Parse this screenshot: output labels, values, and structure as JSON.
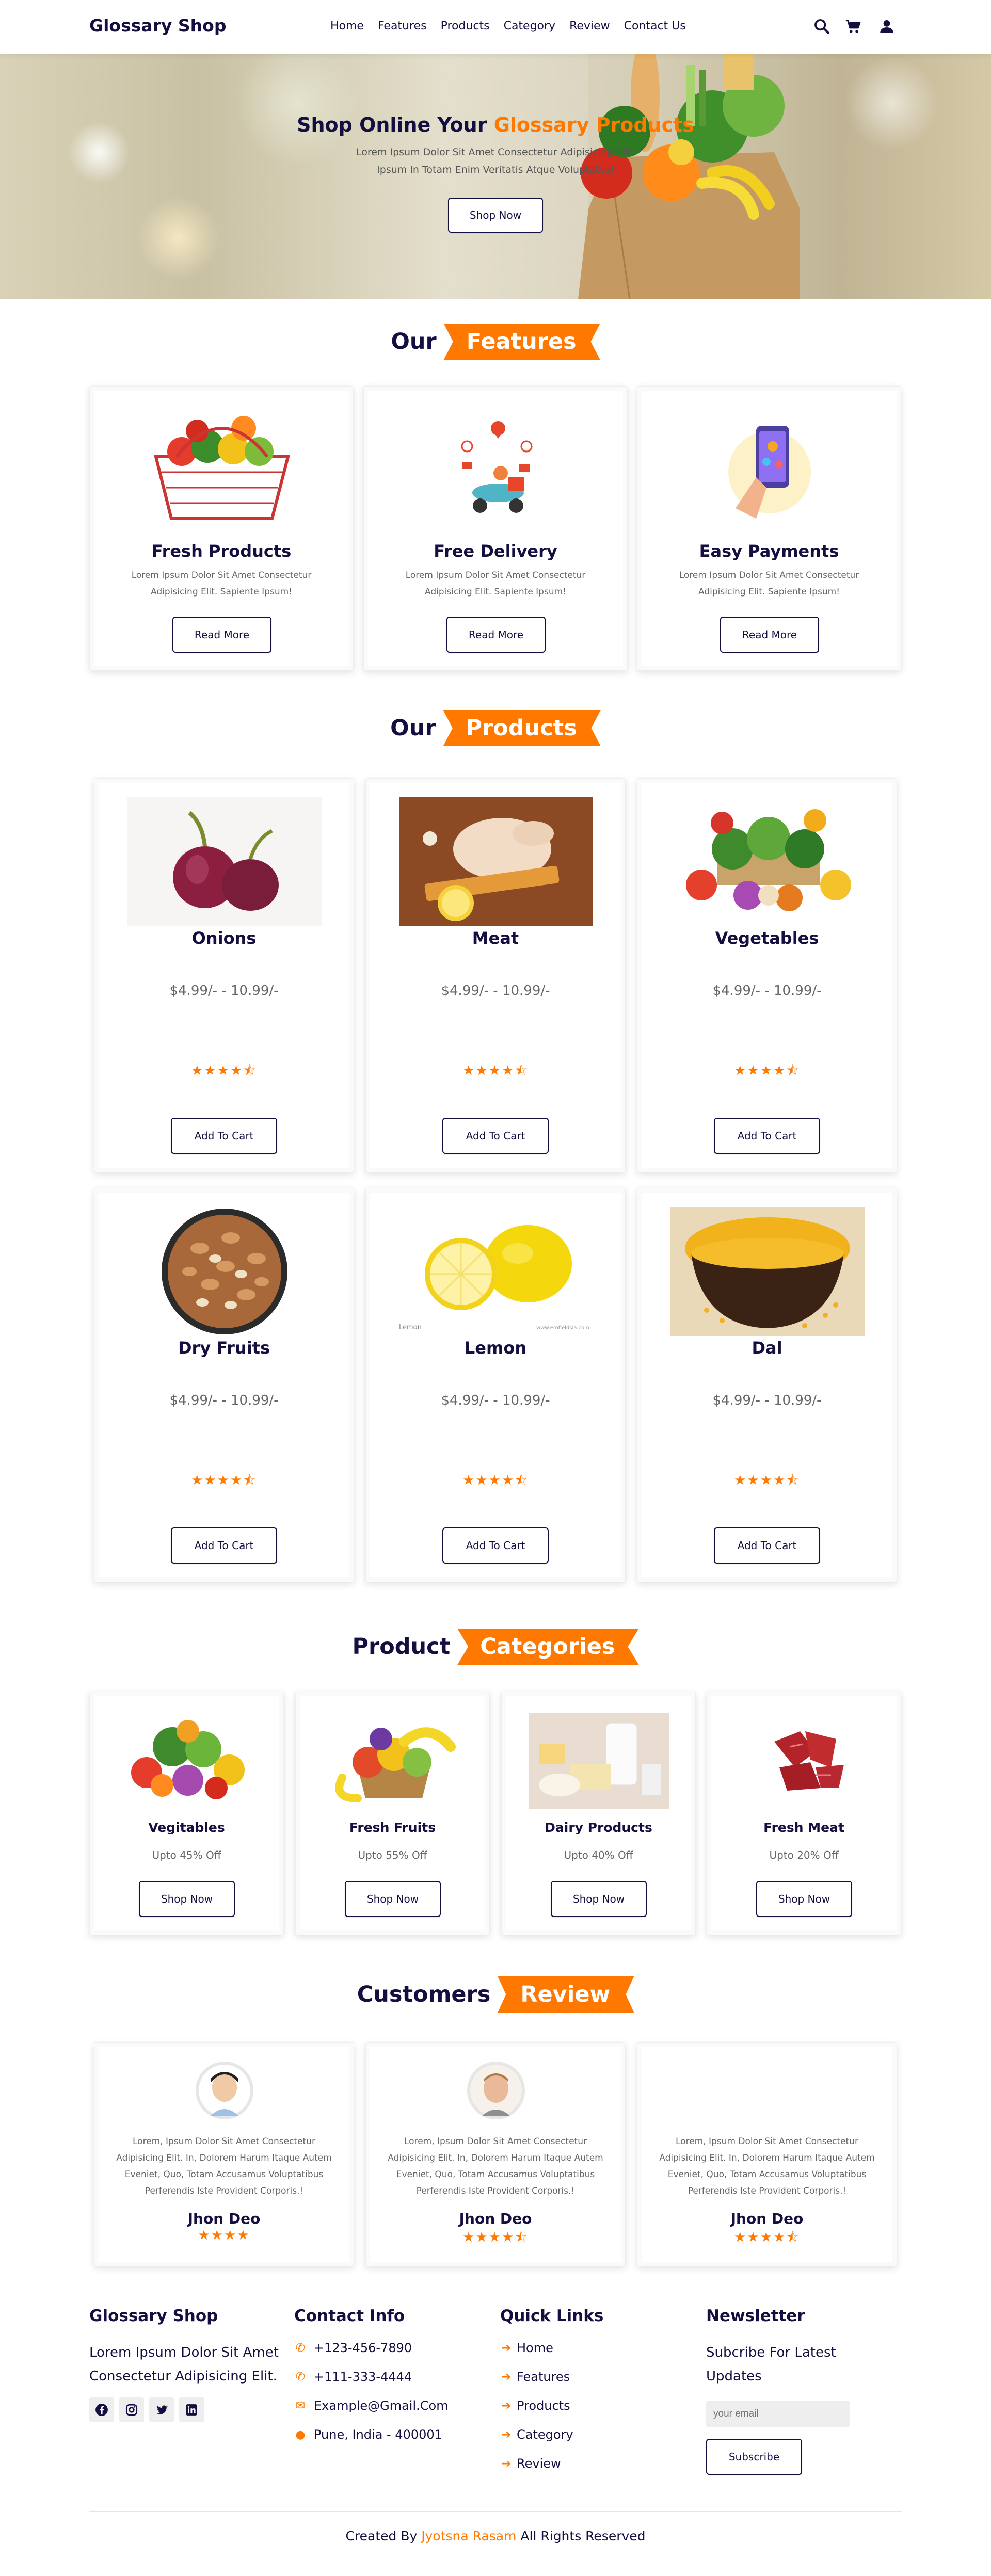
{
  "header": {
    "logo": "Glossary Shop",
    "nav": [
      "Home",
      "Features",
      "Products",
      "Category",
      "Review",
      "Contact Us"
    ],
    "icons": [
      "search-icon",
      "cart-icon",
      "user-icon"
    ]
  },
  "hero": {
    "title_main": "Shop Online Your ",
    "title_highlight": "Glossary Products",
    "subtitle_line1": "Lorem Ipsum Dolor Sit Amet Consectetur Adipisicing Elit.",
    "subtitle_line2": "Ipsum In Totam Enim Veritatis Atque Voluptates!",
    "button": "Shop Now"
  },
  "features": {
    "heading_plain": "Our",
    "heading_tag": "Features",
    "items": [
      {
        "title": "Fresh Products",
        "text1": "Lorem Ipsum Dolor Sit Amet Consectetur",
        "text2": "Adipisicing Elit. Sapiente Ipsum!",
        "button": "Read More"
      },
      {
        "title": "Free Delivery",
        "text1": "Lorem Ipsum Dolor Sit Amet Consectetur",
        "text2": "Adipisicing Elit. Sapiente Ipsum!",
        "button": "Read More"
      },
      {
        "title": "Easy Payments",
        "text1": "Lorem Ipsum Dolor Sit Amet Consectetur",
        "text2": "Adipisicing Elit. Sapiente Ipsum!",
        "button": "Read More"
      }
    ]
  },
  "products": {
    "heading_plain": "Our",
    "heading_tag": "Products",
    "items": [
      {
        "name": "Onions",
        "price": "$4.99/- - 10.99/-",
        "rating": 4.5,
        "button": "Add To Cart"
      },
      {
        "name": "Meat",
        "price": "$4.99/- - 10.99/-",
        "rating": 4.5,
        "button": "Add To Cart"
      },
      {
        "name": "Vegetables",
        "price": "$4.99/- - 10.99/-",
        "rating": 4.5,
        "button": "Add To Cart"
      },
      {
        "name": "Dry Fruits",
        "price": "$4.99/- - 10.99/-",
        "rating": 4.5,
        "button": "Add To Cart"
      },
      {
        "name": "Lemon",
        "price": "$4.99/- - 10.99/-",
        "rating": 4.5,
        "button": "Add To Cart",
        "image_caption_left": "Lemon",
        "image_caption_right": "www.emfieldsia.com"
      },
      {
        "name": "Dal",
        "price": "$4.99/- - 10.99/-",
        "rating": 4.5,
        "button": "Add To Cart"
      }
    ]
  },
  "categories": {
    "heading_plain": "Product",
    "heading_tag": "Categories",
    "items": [
      {
        "name": "Vegitables",
        "discount": "Upto 45% Off",
        "button": "Shop Now"
      },
      {
        "name": "Fresh Fruits",
        "discount": "Upto 55% Off",
        "button": "Shop Now"
      },
      {
        "name": "Dairy Products",
        "discount": "Upto 40% Off",
        "button": "Shop Now"
      },
      {
        "name": "Fresh Meat",
        "discount": "Upto 20% Off",
        "button": "Shop Now"
      }
    ]
  },
  "reviews": {
    "heading_plain": "Customers",
    "heading_tag": "Review",
    "items": [
      {
        "l1": "Lorem, Ipsum Dolor Sit Amet Consectetur",
        "l2": "Adipisicing Elit. In, Dolorem Harum Itaque Autem",
        "l3": "Eveniet, Quo, Totam Accusamus Voluptatibus",
        "l4": "Perferendis Iste Provident Corporis.!",
        "name": "Jhon Deo",
        "rating": 4
      },
      {
        "l1": "Lorem, Ipsum Dolor Sit Amet Consectetur",
        "l2": "Adipisicing Elit. In, Dolorem Harum Itaque Autem",
        "l3": "Eveniet, Quo, Totam Accusamus Voluptatibus",
        "l4": "Perferendis Iste Provident Corporis.!",
        "name": "Jhon Deo",
        "rating": 4.5
      },
      {
        "l1": "Lorem, Ipsum Dolor Sit Amet Consectetur",
        "l2": "Adipisicing Elit. In, Dolorem Harum Itaque Autem",
        "l3": "Eveniet, Quo, Totam Accusamus Voluptatibus",
        "l4": "Perferendis Iste Provident Corporis.!",
        "name": "Jhon Deo",
        "rating": 4.5
      }
    ]
  },
  "footer": {
    "about": {
      "title": "Glossary Shop",
      "text1": "Lorem Ipsum Dolor Sit Amet",
      "text2": "Consectetur Adipisicing Elit.",
      "social": [
        "facebook-icon",
        "instagram-icon",
        "twitter-icon",
        "linkedin-icon"
      ]
    },
    "contact": {
      "title": "Contact Info",
      "phone1": "+123-456-7890",
      "phone2": "+111-333-4444",
      "email": "Example@Gmail.Com",
      "address": "Pune, India - 400001"
    },
    "links": {
      "title": "Quick Links",
      "items": [
        "Home",
        "Features",
        "Products",
        "Category",
        "Review"
      ]
    },
    "newsletter": {
      "title": "Newsletter",
      "text1": "Subcribe For Latest",
      "text2": "Updates",
      "placeholder": "your email",
      "button": "Subscribe"
    },
    "credit_prefix": "Created By ",
    "credit_name": "Jyotsna Rasam",
    "credit_suffix": " All Rights Reserved"
  },
  "colors": {
    "accent": "#ff7800",
    "navy": "#130f40"
  }
}
